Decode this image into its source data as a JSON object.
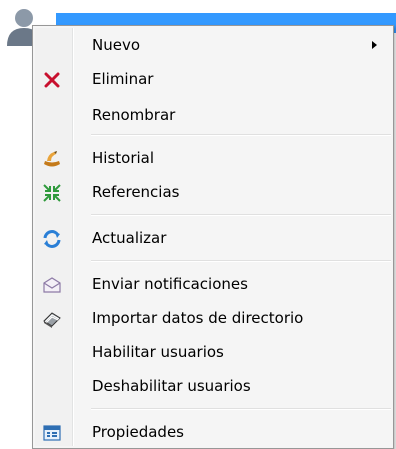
{
  "context_menu": {
    "items": [
      {
        "label": "Nuevo",
        "icon": "none",
        "submenu": true
      },
      {
        "label": "Eliminar",
        "icon": "delete-x-icon"
      },
      {
        "label": "Renombrar",
        "icon": "none"
      },
      {
        "label": "Historial",
        "icon": "history-icon"
      },
      {
        "label": "Referencias",
        "icon": "references-icon"
      },
      {
        "label": "Actualizar",
        "icon": "refresh-icon"
      },
      {
        "label": "Enviar notificaciones",
        "icon": "envelope-icon"
      },
      {
        "label": "Importar datos de directorio",
        "icon": "import-directory-icon"
      },
      {
        "label": "Habilitar usuarios",
        "icon": "none"
      },
      {
        "label": "Deshabilitar usuarios",
        "icon": "none"
      },
      {
        "label": "Propiedades",
        "icon": "properties-icon"
      }
    ]
  },
  "colors": {
    "selection": "#3399ff",
    "menu_background": "#f5f5f5",
    "delete_icon": "#c8102e"
  }
}
